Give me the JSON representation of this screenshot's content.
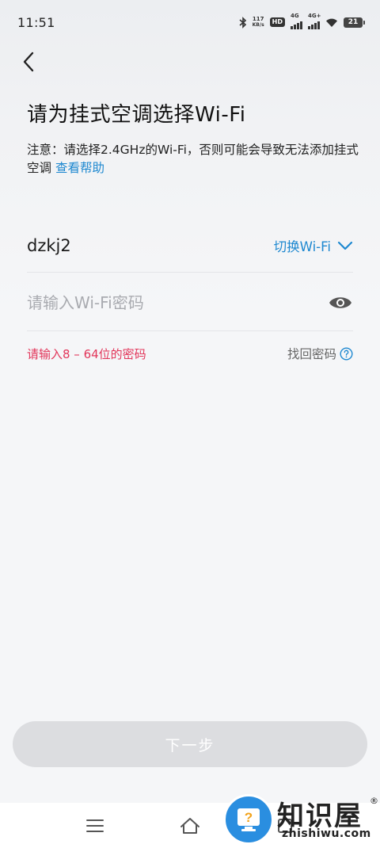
{
  "status_bar": {
    "time": "11:51",
    "net_speed_value": "117",
    "net_speed_unit": "KB/s",
    "hd_label": "HD",
    "sim1_label": "4G",
    "sim2_label": "4G+",
    "battery": "21",
    "icons": [
      "bluetooth-icon",
      "hd-icon",
      "signal-icon",
      "signal-icon",
      "wifi-icon",
      "battery-icon"
    ]
  },
  "header": {
    "back_icon": "chevron-left-icon"
  },
  "page": {
    "title": "请为挂式空调选择Wi-Fi",
    "notice": "注意：请选择2.4GHz的Wi-Fi，否则可能会导致无法添加挂式空调",
    "help_link": "查看帮助"
  },
  "wifi": {
    "ssid": "dzkj2",
    "switch_label": "切换Wi-Fi",
    "switch_icon": "chevron-down-icon"
  },
  "password": {
    "placeholder": "请输入Wi-Fi密码",
    "value": "",
    "eye_icon": "eye-icon",
    "hint": "请输入8 – 64位的密码",
    "forgot_label": "找回密码",
    "forgot_icon": "question-circle-icon"
  },
  "footer": {
    "next_label": "下一步"
  },
  "nav_bar": {
    "icons": [
      "menu-icon",
      "home-icon",
      "back-square-icon"
    ]
  },
  "watermark": {
    "cn_text": "知识屋",
    "en_text": "zhishiwu.com",
    "reg_mark": "®"
  },
  "colors": {
    "accent": "#1e88d0",
    "error": "#e2365a",
    "button_disabled": "#dcdde0"
  }
}
